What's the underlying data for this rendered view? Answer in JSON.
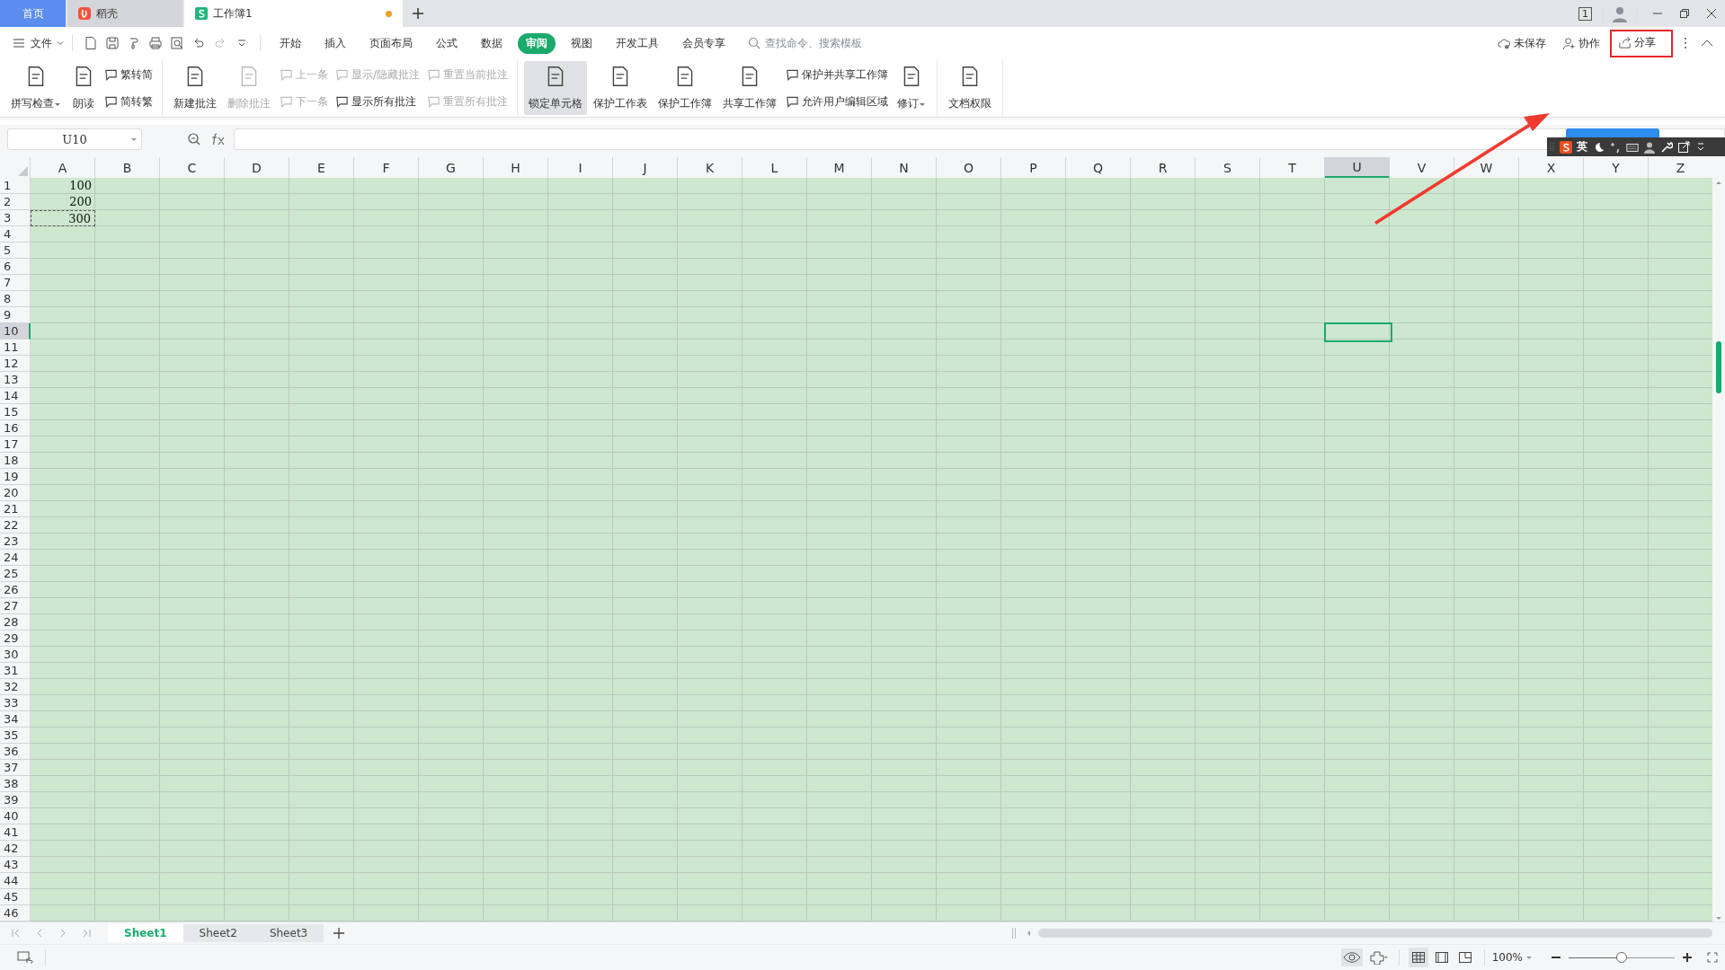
{
  "tabs": [
    {
      "label": "首页",
      "kind": "home",
      "selected": false
    },
    {
      "label": "稻壳",
      "kind": "docer",
      "selected": false
    },
    {
      "label": "工作簿1",
      "kind": "sheet",
      "selected": true,
      "unsaved": true
    }
  ],
  "window_count": "1",
  "menu": {
    "file": "文件",
    "items": [
      {
        "label": "开始",
        "selected": false
      },
      {
        "label": "插入",
        "selected": false
      },
      {
        "label": "页面布局",
        "selected": false
      },
      {
        "label": "公式",
        "selected": false
      },
      {
        "label": "数据",
        "selected": false
      },
      {
        "label": "审阅",
        "selected": true
      },
      {
        "label": "视图",
        "selected": false
      },
      {
        "label": "开发工具",
        "selected": false
      },
      {
        "label": "会员专享",
        "selected": false
      }
    ],
    "search": {
      "placeholder": "查找命令、搜索模板"
    },
    "actions": [
      {
        "label": "未保存",
        "highlighted": false
      },
      {
        "label": "协作",
        "highlighted": false
      },
      {
        "label": "分享",
        "highlighted": true
      }
    ]
  },
  "ribbon": [
    [
      {
        "kind": "large",
        "label": "拼写检查",
        "disabled": false,
        "selected": false,
        "dropdown": true
      },
      {
        "kind": "large",
        "label": "朗读",
        "disabled": false,
        "selected": false,
        "dropdown": false
      },
      {
        "kind": "stack",
        "items": [
          {
            "label": "繁转简",
            "disabled": false
          },
          {
            "label": "简转繁",
            "disabled": false
          }
        ]
      }
    ],
    [
      {
        "kind": "large",
        "label": "新建批注",
        "disabled": false,
        "selected": false,
        "dropdown": false
      },
      {
        "kind": "large",
        "label": "删除批注",
        "disabled": true,
        "selected": false,
        "dropdown": false
      },
      {
        "kind": "stack",
        "items": [
          {
            "label": "上一条",
            "disabled": true
          },
          {
            "label": "下一条",
            "disabled": true
          }
        ]
      },
      {
        "kind": "stack",
        "items": [
          {
            "label": "显示/隐藏批注",
            "disabled": true
          },
          {
            "label": "显示所有批注",
            "disabled": false
          }
        ]
      },
      {
        "kind": "stack",
        "items": [
          {
            "label": "重置当前批注",
            "disabled": true
          },
          {
            "label": "重置所有批注",
            "disabled": true
          }
        ]
      }
    ],
    [
      {
        "kind": "large",
        "label": "锁定单元格",
        "disabled": false,
        "selected": true,
        "dropdown": false
      },
      {
        "kind": "large",
        "label": "保护工作表",
        "disabled": false,
        "selected": false,
        "dropdown": false
      },
      {
        "kind": "large",
        "label": "保护工作簿",
        "disabled": false,
        "selected": false,
        "dropdown": false
      },
      {
        "kind": "large",
        "label": "共享工作簿",
        "disabled": false,
        "selected": false,
        "dropdown": false
      },
      {
        "kind": "stack",
        "items": [
          {
            "label": "保护并共享工作簿",
            "disabled": false
          },
          {
            "label": "允许用户编辑区域",
            "disabled": false
          }
        ]
      },
      {
        "kind": "large",
        "label": "修订",
        "disabled": false,
        "selected": false,
        "dropdown": true
      }
    ],
    [
      {
        "kind": "large",
        "label": "文档权限",
        "disabled": false,
        "selected": false,
        "dropdown": false
      }
    ]
  ],
  "name_box": "U10",
  "columns": [
    {
      "label": "A",
      "selected": false
    },
    {
      "label": "B",
      "selected": false
    },
    {
      "label": "C",
      "selected": false
    },
    {
      "label": "D",
      "selected": false
    },
    {
      "label": "E",
      "selected": false
    },
    {
      "label": "F",
      "selected": false
    },
    {
      "label": "G",
      "selected": false
    },
    {
      "label": "H",
      "selected": false
    },
    {
      "label": "I",
      "selected": false
    },
    {
      "label": "J",
      "selected": false
    },
    {
      "label": "K",
      "selected": false
    },
    {
      "label": "L",
      "selected": false
    },
    {
      "label": "M",
      "selected": false
    },
    {
      "label": "N",
      "selected": false
    },
    {
      "label": "O",
      "selected": false
    },
    {
      "label": "P",
      "selected": false
    },
    {
      "label": "Q",
      "selected": false
    },
    {
      "label": "R",
      "selected": false
    },
    {
      "label": "S",
      "selected": false
    },
    {
      "label": "T",
      "selected": false
    },
    {
      "label": "U",
      "selected": true
    },
    {
      "label": "V",
      "selected": false
    },
    {
      "label": "W",
      "selected": false
    },
    {
      "label": "X",
      "selected": false
    },
    {
      "label": "Y",
      "selected": false
    },
    {
      "label": "Z",
      "selected": false
    }
  ],
  "rows": [
    {
      "label": "1",
      "selected": false,
      "cells": [
        {
          "text": "100",
          "copy_marquee": false
        }
      ]
    },
    {
      "label": "2",
      "selected": false,
      "cells": [
        {
          "text": "200",
          "copy_marquee": false
        }
      ]
    },
    {
      "label": "3",
      "selected": false,
      "cells": [
        {
          "text": "300",
          "copy_marquee": true
        }
      ]
    },
    {
      "label": "4",
      "selected": false
    },
    {
      "label": "5",
      "selected": false
    },
    {
      "label": "6",
      "selected": false
    },
    {
      "label": "7",
      "selected": false
    },
    {
      "label": "8",
      "selected": false
    },
    {
      "label": "9",
      "selected": false
    },
    {
      "label": "10",
      "selected": true
    },
    {
      "label": "11",
      "selected": false
    },
    {
      "label": "12",
      "selected": false
    },
    {
      "label": "13",
      "selected": false
    },
    {
      "label": "14",
      "selected": false
    },
    {
      "label": "15",
      "selected": false
    },
    {
      "label": "16",
      "selected": false
    },
    {
      "label": "17",
      "selected": false
    },
    {
      "label": "18",
      "selected": false
    },
    {
      "label": "19",
      "selected": false
    },
    {
      "label": "20",
      "selected": false
    },
    {
      "label": "21",
      "selected": false
    },
    {
      "label": "22",
      "selected": false
    },
    {
      "label": "23",
      "selected": false
    },
    {
      "label": "24",
      "selected": false
    },
    {
      "label": "25",
      "selected": false
    },
    {
      "label": "26",
      "selected": false
    },
    {
      "label": "27",
      "selected": false
    },
    {
      "label": "28",
      "selected": false
    },
    {
      "label": "29",
      "selected": false
    },
    {
      "label": "30",
      "selected": false
    },
    {
      "label": "31",
      "selected": false
    },
    {
      "label": "32",
      "selected": false
    },
    {
      "label": "33",
      "selected": false
    },
    {
      "label": "34",
      "selected": false
    },
    {
      "label": "35",
      "selected": false
    },
    {
      "label": "36",
      "selected": false
    },
    {
      "label": "37",
      "selected": false
    },
    {
      "label": "38",
      "selected": false
    },
    {
      "label": "39",
      "selected": false
    },
    {
      "label": "40",
      "selected": false
    },
    {
      "label": "41",
      "selected": false
    },
    {
      "label": "42",
      "selected": false
    },
    {
      "label": "43",
      "selected": false
    },
    {
      "label": "44",
      "selected": false
    },
    {
      "label": "45",
      "selected": false
    },
    {
      "label": "46",
      "selected": false
    }
  ],
  "ime_toolbar": {
    "mode": "英"
  },
  "sheets": [
    {
      "label": "Sheet1",
      "selected": true
    },
    {
      "label": "Sheet2",
      "selected": false
    },
    {
      "label": "Sheet3",
      "selected": false
    }
  ],
  "status_bar": {
    "views": [
      {
        "selected": true
      },
      {
        "selected": false
      },
      {
        "selected": false
      }
    ],
    "zoom": "100%",
    "zoom_slider": {
      "level": 0.5
    }
  },
  "annotation": {
    "arrow": true
  }
}
